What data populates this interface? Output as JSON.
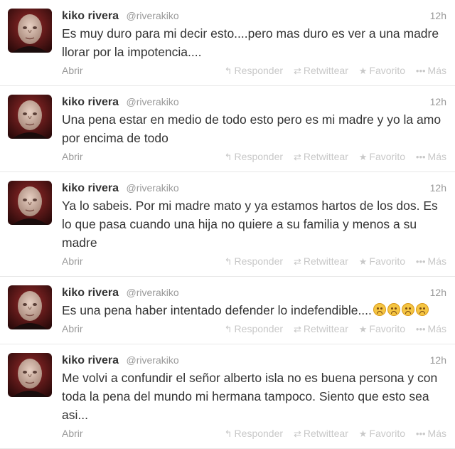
{
  "tweets": [
    {
      "fullname": "kiko rivera",
      "username": "@riverakiko",
      "time": "12h",
      "text": "Es muy duro para mi decir esto....pero mas duro es ver a una madre llorar por la impotencia....",
      "emoji_count": 0,
      "open_label": "Abrir"
    },
    {
      "fullname": "kiko rivera",
      "username": "@riverakiko",
      "time": "12h",
      "text": "Una pena estar en medio de todo esto pero es mi madre y yo la amo por encima de todo",
      "emoji_count": 0,
      "open_label": "Abrir"
    },
    {
      "fullname": "kiko rivera",
      "username": "@riverakiko",
      "time": "12h",
      "text": "Ya lo sabeis. Por mi madre mato y ya estamos hartos de los dos. Es lo que pasa cuando una hija no quiere a su familia y menos a su madre",
      "emoji_count": 0,
      "open_label": "Abrir"
    },
    {
      "fullname": "kiko rivera",
      "username": "@riverakiko",
      "time": "12h",
      "text": "Es una pena haber intentado defender lo indefendible....",
      "emoji_count": 4,
      "emoji_icon": "disappointed-face-icon",
      "open_label": "Abrir"
    },
    {
      "fullname": "kiko rivera",
      "username": "@riverakiko",
      "time": "12h",
      "text": "Me volvi a confundir el señor alberto isla no es buena persona y con toda la pena del mundo mi hermana tampoco. Siento que esto sea asi...",
      "emoji_count": 0,
      "open_label": "Abrir"
    }
  ],
  "actions": {
    "reply": "Responder",
    "retweet": "Retwittear",
    "favorite": "Favorito",
    "more": "Más"
  },
  "icons": {
    "reply": "reply-arrow-icon",
    "retweet": "retweet-icon",
    "favorite": "star-icon",
    "more": "more-dots-icon"
  },
  "colors": {
    "text": "#333333",
    "muted": "#999999",
    "action": "#c8c8c8",
    "divider": "#e8e8e8"
  }
}
